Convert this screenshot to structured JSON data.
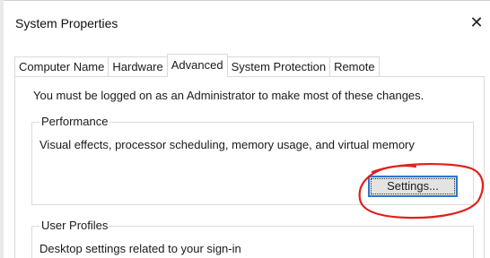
{
  "window": {
    "title": "System Properties",
    "close_glyph": "✕"
  },
  "tabs": [
    {
      "label": "Computer Name",
      "active": false
    },
    {
      "label": "Hardware",
      "active": false
    },
    {
      "label": "Advanced",
      "active": true
    },
    {
      "label": "System Protection",
      "active": false
    },
    {
      "label": "Remote",
      "active": false
    }
  ],
  "advanced": {
    "admin_note": "You must be logged on as an Administrator to make most of these changes.",
    "performance": {
      "label": "Performance",
      "description": "Visual effects, processor scheduling, memory usage, and virtual memory",
      "settings_label": "Settings..."
    },
    "user_profiles": {
      "label": "User Profiles",
      "description": "Desktop settings related to your sign-in"
    }
  },
  "colors": {
    "focus_border": "#2b77d3",
    "annotation_circle": "#e0201c",
    "button_face": "#e3e3e3"
  }
}
